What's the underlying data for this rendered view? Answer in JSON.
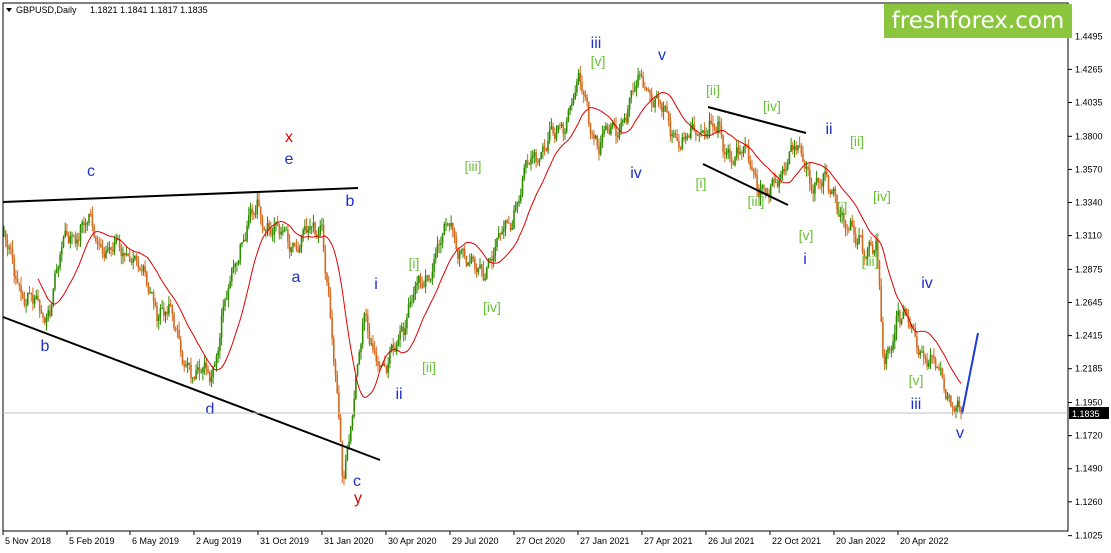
{
  "chart_header": {
    "symbol": "GBPUSD,Daily",
    "ohlc": "1.1821 1.1841 1.1817 1.1835"
  },
  "brand": {
    "logo_text": "freshforex.com",
    "color": "#8cc63f"
  },
  "colors": {
    "bull": "#2e8b00",
    "bear": "#d2691e",
    "ma": "#e00000",
    "blue_label": "#1f2fc8",
    "green_label": "#6ac23a",
    "red_label": "#e00000"
  },
  "chart_data": {
    "type": "candlestick",
    "title": "GBPUSD,Daily",
    "ylim": [
      1.1,
      1.465
    ],
    "y_ticks": [
      "1.4495",
      "1.4265",
      "1.4035",
      "1.3800",
      "1.3570",
      "1.3340",
      "1.3110",
      "1.2875",
      "1.2645",
      "1.2415",
      "1.2185",
      "1.1950",
      "1.1720",
      "1.1490",
      "1.1260",
      "1.1025"
    ],
    "current_price": "1.1835",
    "x_ticks": [
      "5 Nov 2018",
      "5 Feb 2019",
      "6 May 2019",
      "2 Aug 2019",
      "31 Oct 2019",
      "31 Jan 2020",
      "30 Apr 2020",
      "29 Jul 2020",
      "27 Oct 2020",
      "27 Jan 2021",
      "27 Apr 2021",
      "26 Jul 2021",
      "22 Oct 2021",
      "20 Jan 2022",
      "20 Apr 2022"
    ],
    "series": [
      {
        "name": "price",
        "points": [
          [
            "5 Nov 2018",
            1.31
          ],
          [
            "Dec 2018",
            1.27
          ],
          [
            "Jan 2019",
            1.255
          ],
          [
            "5 Feb 2019",
            1.312
          ],
          [
            "Mar 2019",
            1.318
          ],
          [
            "Apr 2019",
            1.3
          ],
          [
            "6 May 2019",
            1.3
          ],
          [
            "Jun 2019",
            1.27
          ],
          [
            "Jul 2019",
            1.25
          ],
          [
            "2 Aug 2019",
            1.21
          ],
          [
            "Sep 2019",
            1.225
          ],
          [
            "Oct 2019",
            1.3
          ],
          [
            "31 Oct 2019",
            1.33
          ],
          [
            "Dec 2019",
            1.31
          ],
          [
            "Jan 2020",
            1.305
          ],
          [
            "31 Jan 2020",
            1.32
          ],
          [
            "Mar 2020",
            1.145
          ],
          [
            "Apr 2020",
            1.25
          ],
          [
            "30 Apr 2020",
            1.215
          ],
          [
            "Jun 2020",
            1.26
          ],
          [
            "Jul 2020",
            1.285
          ],
          [
            "29 Jul 2020",
            1.32
          ],
          [
            "Sep 2020",
            1.285
          ],
          [
            "Oct 2020",
            1.295
          ],
          [
            "27 Oct 2020",
            1.33
          ],
          [
            "Dec 2020",
            1.37
          ],
          [
            "Jan 2021",
            1.38
          ],
          [
            "27 Jan 2021",
            1.415
          ],
          [
            "Mar 2021",
            1.375
          ],
          [
            "Apr 2021",
            1.39
          ],
          [
            "27 Apr 2021",
            1.422
          ],
          [
            "Jun 2021",
            1.395
          ],
          [
            "Jul 2021",
            1.375
          ],
          [
            "26 Jul 2021",
            1.39
          ],
          [
            "Sep 2021",
            1.37
          ],
          [
            "Oct 2021",
            1.365
          ],
          [
            "22 Oct 2021",
            1.335
          ],
          [
            "Dec 2021",
            1.375
          ],
          [
            "Jan 2022",
            1.352
          ],
          [
            "20 Jan 2022",
            1.34
          ],
          [
            "Feb 2022",
            1.305
          ],
          [
            "Mar 2022",
            1.305
          ],
          [
            "Apr 2022",
            1.215
          ],
          [
            "20 Apr 2022",
            1.26
          ],
          [
            "May 2022",
            1.225
          ],
          [
            "Jun 2022",
            1.185
          ]
        ]
      },
      {
        "name": "moving average"
      }
    ],
    "wave_labels": [
      {
        "text": "c",
        "color": "blue"
      },
      {
        "text": "x",
        "color": "red"
      },
      {
        "text": "e",
        "color": "blue"
      },
      {
        "text": "b",
        "color": "blue"
      },
      {
        "text": "a",
        "color": "blue"
      },
      {
        "text": "b",
        "color": "blue"
      },
      {
        "text": "d",
        "color": "blue"
      },
      {
        "text": "c",
        "color": "blue"
      },
      {
        "text": "y",
        "color": "red"
      },
      {
        "text": "i",
        "color": "blue"
      },
      {
        "text": "ii",
        "color": "blue"
      },
      {
        "text": "[i]",
        "color": "green"
      },
      {
        "text": "[ii]",
        "color": "green"
      },
      {
        "text": "[iii]",
        "color": "green"
      },
      {
        "text": "[iv]",
        "color": "green"
      },
      {
        "text": "iii",
        "color": "blue"
      },
      {
        "text": "[v]",
        "color": "green"
      },
      {
        "text": "iv",
        "color": "blue"
      },
      {
        "text": "v",
        "color": "blue"
      },
      {
        "text": "[ii]",
        "color": "green"
      },
      {
        "text": "[iv]",
        "color": "green"
      },
      {
        "text": "[i]",
        "color": "green"
      },
      {
        "text": "[iii]",
        "color": "green"
      },
      {
        "text": "ii",
        "color": "blue"
      },
      {
        "text": "[ii]",
        "color": "green"
      },
      {
        "text": "[v]",
        "color": "green"
      },
      {
        "text": "i",
        "color": "blue"
      },
      {
        "text": "[i]",
        "color": "green"
      },
      {
        "text": "[iv]",
        "color": "green"
      },
      {
        "text": "[iii]",
        "color": "green"
      },
      {
        "text": "iv",
        "color": "blue"
      },
      {
        "text": "[v]",
        "color": "green"
      },
      {
        "text": "iii",
        "color": "blue"
      },
      {
        "text": "v",
        "color": "blue"
      }
    ]
  }
}
